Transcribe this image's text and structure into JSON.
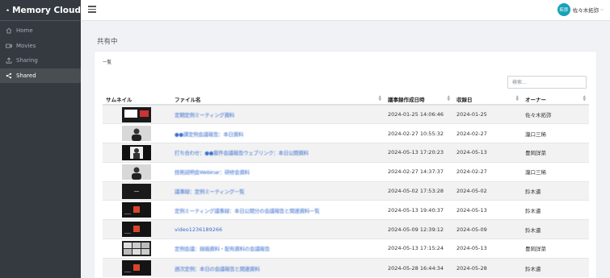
{
  "brand": {
    "name": "Memory Cloud"
  },
  "sidebar": {
    "items": [
      {
        "label": "Home",
        "icon": "home-icon",
        "active": false
      },
      {
        "label": "Movies",
        "icon": "video-icon",
        "active": false
      },
      {
        "label": "Sharing",
        "icon": "upload-icon",
        "active": false
      },
      {
        "label": "Shared",
        "icon": "share-icon",
        "active": true
      }
    ]
  },
  "header": {
    "user": {
      "avatar": "拓弥",
      "name": "佐々木拓弥"
    }
  },
  "page": {
    "title": "共有中",
    "card_title": "一覧",
    "search_placeholder": "検索..."
  },
  "table": {
    "columns": [
      "サムネイル",
      "ファイル名",
      "議事録作成日時",
      "収録日",
      "オーナー"
    ],
    "rows": [
      {
        "thumb": "dark-screen",
        "file": "定期定例ミーティング資料",
        "created": "2024-01-25 14:06:46",
        "recorded": "2024-01-25",
        "owner": "佐々木拓弥"
      },
      {
        "thumb": "person-light",
        "file": "●●課定例会議報告：本日資料",
        "created": "2024-02-27 10:55:32",
        "recorded": "2024-02-27",
        "owner": "瀧口三稀"
      },
      {
        "thumb": "person-dark",
        "file": "打ち合わせ：●●案件会議報告ウェブリンク：本日公開資料",
        "created": "2024-05-13 17:20:23",
        "recorded": "2024-05-13",
        "owner": "豊岡詳菜"
      },
      {
        "thumb": "person-light",
        "file": "技術説明会Webinar：研修会資料",
        "created": "2024-02-27 14:37:37",
        "recorded": "2024-02-27",
        "owner": "瀧口三稀"
      },
      {
        "thumb": "black",
        "file": "議事録：定例ミーティング一覧",
        "created": "2024-05-02 17:53:28",
        "recorded": "2024-05-02",
        "owner": "鈴木遣"
      },
      {
        "thumb": "red-logo",
        "file": "定例ミーティング議事録：本日公開分の会議報告と関連資料一覧",
        "created": "2024-05-13 19:40:37",
        "recorded": "2024-05-13",
        "owner": "鈴木遣"
      },
      {
        "thumb": "red-logo",
        "file": "video1236189266",
        "created": "2024-05-09 12:39:12",
        "recorded": "2024-05-09",
        "owner": "鈴木遣"
      },
      {
        "thumb": "grid-faces",
        "file": "定例会議：録画資料・配布資料の会議報告",
        "created": "2024-05-13 17:15:24",
        "recorded": "2024-05-13",
        "owner": "豊岡詳菜"
      },
      {
        "thumb": "red-logo",
        "file": "週次定例：本日の会議報告と関連資料",
        "created": "2024-05-28 16:44:34",
        "recorded": "2024-05-28",
        "owner": "鈴木遣"
      }
    ]
  },
  "colors": {
    "sidebar": "#343a40",
    "link": "#3b6fd1",
    "avatar": "#17a2b8"
  }
}
